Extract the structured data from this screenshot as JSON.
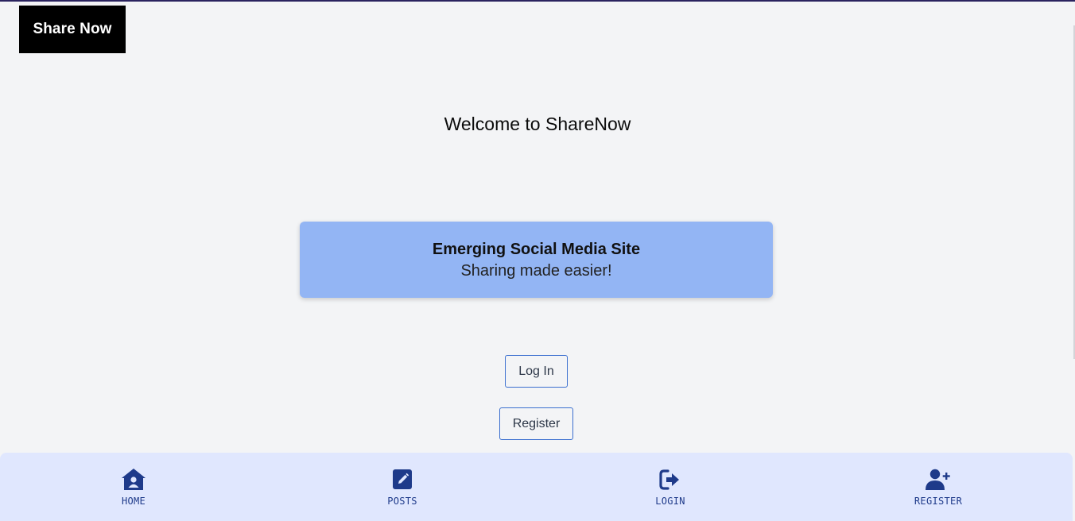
{
  "brand": {
    "label": "Share Now"
  },
  "welcome": {
    "title": "Welcome to ShareNow"
  },
  "hero": {
    "title": "Emerging Social Media Site",
    "subtitle": "Sharing made easier!"
  },
  "actions": {
    "login_label": "Log In",
    "register_label": "Register"
  },
  "bottom_nav": {
    "items": [
      {
        "label": "HOME",
        "icon": "home-icon"
      },
      {
        "label": "POSTS",
        "icon": "edit-icon"
      },
      {
        "label": "LOGIN",
        "icon": "login-icon"
      },
      {
        "label": "REGISTER",
        "icon": "user-plus-icon"
      }
    ]
  },
  "colors": {
    "background": "#f3f4f6",
    "brand_bg": "#000000",
    "hero_bg": "#93b5f4",
    "button_border": "#3b6fcf",
    "nav_bg": "#e0e7fe",
    "nav_accent": "#1e3a8a"
  }
}
